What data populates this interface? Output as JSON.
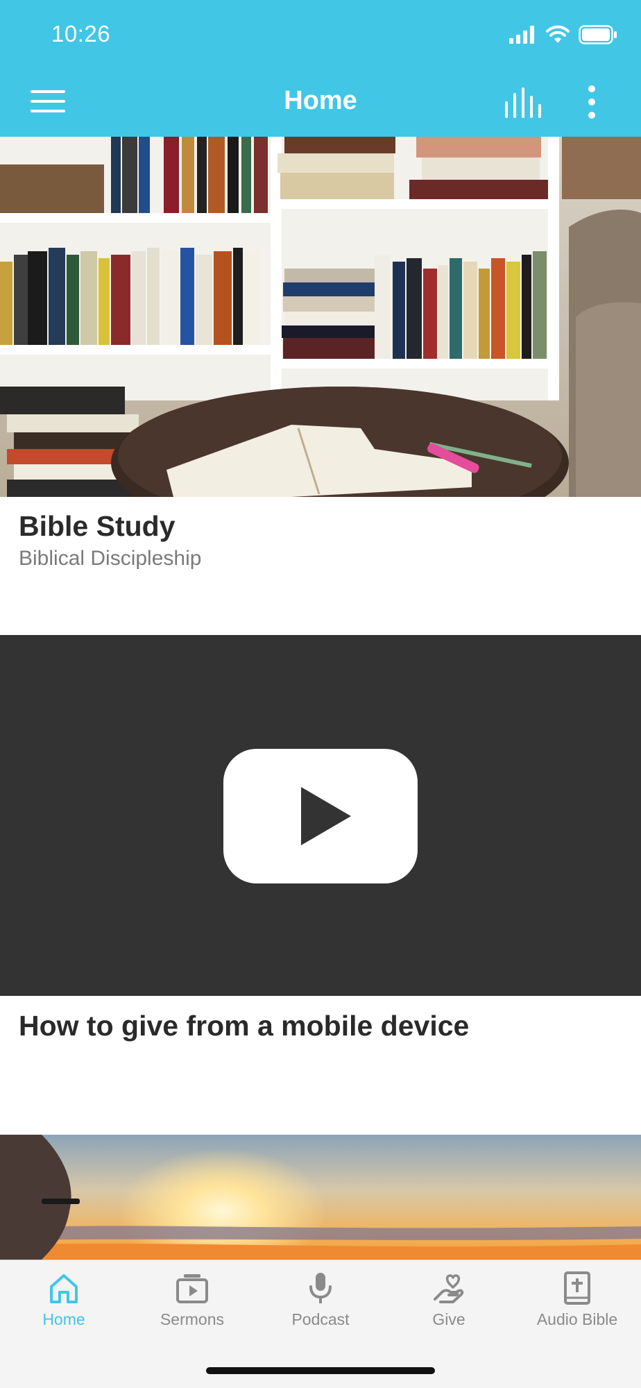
{
  "status_bar": {
    "time": "10:26"
  },
  "header": {
    "title": "Home",
    "background": "#41c6e6"
  },
  "cards": [
    {
      "title": "Bible Study",
      "subtitle": "Biblical Discipleship",
      "image": "bookshelf-with-open-bible"
    },
    {
      "title": "How to give from a mobile device",
      "image": "youtube-video-placeholder"
    },
    {
      "image": "sunset-silhouette"
    }
  ],
  "tabs": [
    {
      "label": "Home",
      "icon": "home-icon",
      "active": true
    },
    {
      "label": "Sermons",
      "icon": "video-player-icon",
      "active": false
    },
    {
      "label": "Podcast",
      "icon": "microphone-icon",
      "active": false
    },
    {
      "label": "Give",
      "icon": "giving-hand-heart-icon",
      "active": false
    },
    {
      "label": "Audio Bible",
      "icon": "bible-icon",
      "active": false
    }
  ],
  "colors": {
    "accent": "#41c6e6",
    "inactive_tab": "#8a8a8a",
    "video_bg": "#333333"
  }
}
